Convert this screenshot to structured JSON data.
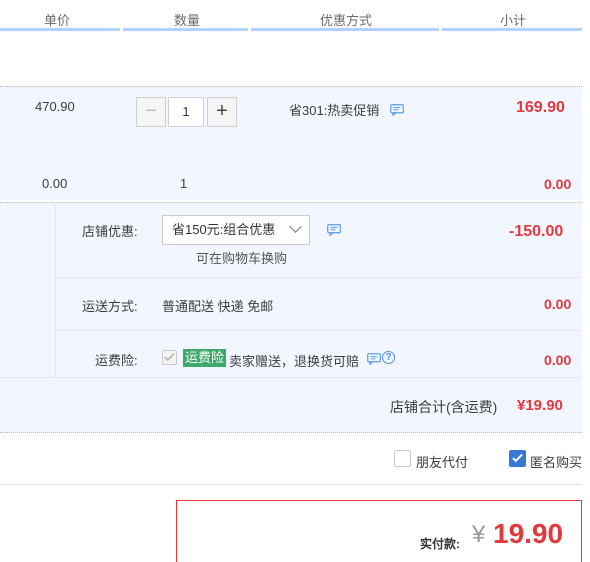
{
  "header": {
    "col_unit_price": "单价",
    "col_quantity": "数量",
    "col_promotion": "优惠方式",
    "col_subtotal": "小计"
  },
  "item": {
    "unit_price": "470.90",
    "quantity": "1",
    "minus_symbol": "−",
    "plus_symbol": "+",
    "promotion": "省301:热卖促销",
    "subtotal": "169.90"
  },
  "gift": {
    "unit_price": "0.00",
    "quantity": "1",
    "subtotal": "0.00"
  },
  "shop": {
    "discount_label": "店铺优惠:",
    "discount_selected": "省150元:组合优惠",
    "discount_note": "可在购物车换购",
    "discount_amount": "-150.00",
    "shipping_label": "运送方式:",
    "shipping_value": "普通配送 快递 免邮",
    "shipping_amount": "0.00",
    "insurance_label": "运费险:",
    "insurance_tag": "运费险",
    "insurance_desc": "卖家赠送，退换货可赔",
    "insurance_amount": "0.00",
    "insurance_q": "?",
    "total_label": "店铺合计(含运费)",
    "total_amount": "¥19.90"
  },
  "options": {
    "friend_pay": "朋友代付",
    "anonymous": "匿名购买",
    "friend_pay_checked": false,
    "anonymous_checked": true
  },
  "payment": {
    "label": "实付款:",
    "currency": "¥",
    "amount": "19.90"
  },
  "colors": {
    "accent_red": "#e4393c",
    "accent_blue": "#3a78d6",
    "row_bg": "#f2f7ff",
    "tag_green": "#3ea86a"
  }
}
